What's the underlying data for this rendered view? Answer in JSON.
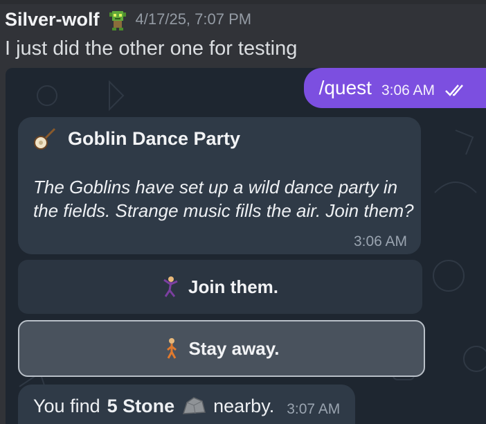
{
  "message": {
    "username": "Silver-wolf",
    "badge_icon": "goblin-icon",
    "timestamp": "4/17/25, 7:07 PM",
    "text": "I just did the other one for testing"
  },
  "embed": {
    "outgoing": {
      "command": "/quest",
      "time": "3:06 AM",
      "status_icon": "double-check-icon"
    },
    "quest": {
      "icon": "banjo-icon",
      "title": "Goblin Dance Party",
      "body": "The Goblins have set up a wild dance party in the fields. Strange music fills the air. Join them?",
      "time": "3:06 AM"
    },
    "buttons": [
      {
        "label": "Join them.",
        "icon": "dancing-person-icon"
      },
      {
        "label": "Stay away.",
        "icon": "walking-person-icon"
      }
    ],
    "result": {
      "prefix": "You find",
      "item": "5 Stone",
      "item_icon": "rock-icon",
      "suffix": "nearby.",
      "time": "3:07 AM"
    }
  },
  "colors": {
    "outgoing_bubble": "#7c4fe0",
    "incoming_bubble": "#2f3a47",
    "chat_background": "#1e2630",
    "discord_background": "#313338"
  }
}
